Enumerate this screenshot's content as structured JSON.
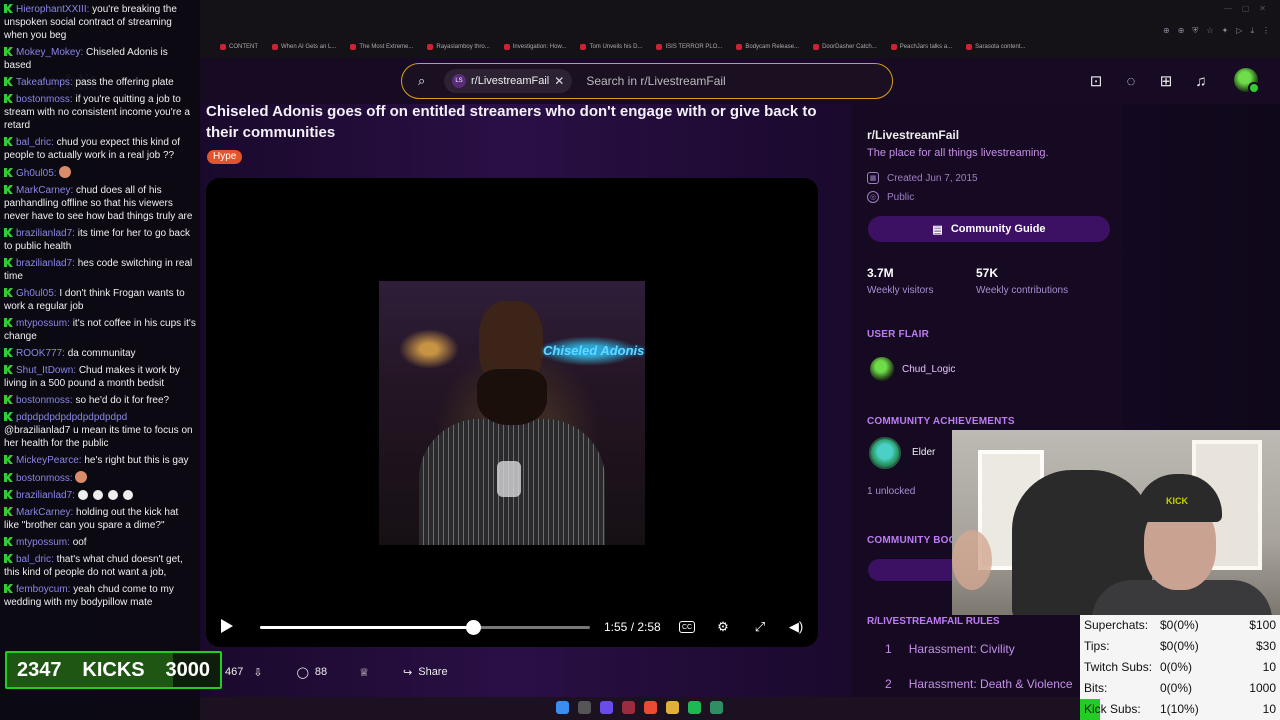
{
  "chat": {
    "messages": [
      {
        "user": "HierophantXXIII:",
        "text": "you're breaking the unspoken social contract of streaming when you beg"
      },
      {
        "user": "Mokey_Mokey:",
        "text": "Chiseled Adonis is based"
      },
      {
        "user": "Takeafumps:",
        "text": "pass the offering plate"
      },
      {
        "user": "bostonmoss:",
        "text": "if you're quitting a job to stream with no consistent income you're a retard"
      },
      {
        "user": "bal_dric:",
        "text": "chud you expect this kind of people to actually work in a real job ??"
      },
      {
        "user": "Gh0ul05:",
        "text": ""
      },
      {
        "user": "MarkCarney:",
        "text": "chud does all of his panhandling offline so that his viewers never have to see how bad things truly are"
      },
      {
        "user": "brazilianlad7:",
        "text": "its time for her to go back to public health"
      },
      {
        "user": "brazilianlad7:",
        "text": "hes code switching in real time"
      },
      {
        "user": "Gh0ul05:",
        "text": "I don't think Frogan wants to work a regular job"
      },
      {
        "user": "mtypossum:",
        "text": "it's not coffee in his cups it's change"
      },
      {
        "user": "ROOK777:",
        "text": "da communitay"
      },
      {
        "user": "Shut_ItDown:",
        "text": "Chud makes it work by living in a 500 pound a month bedsit"
      },
      {
        "user": "bostonmoss:",
        "text": "so he'd do it for free?"
      },
      {
        "user": "pdpdpdpdpdpdpdpdpdpd",
        "text": "@brazilianlad7 u mean its time to focus on her health for the public"
      },
      {
        "user": "MickeyPearce:",
        "text": "he's right but this is gay"
      },
      {
        "user": "bostonmoss:",
        "text": ""
      },
      {
        "user": "brazilianlad7:",
        "text": ""
      },
      {
        "user": "MarkCarney:",
        "text": "holding out the kick hat like \"brother can you spare a dime?\""
      },
      {
        "user": "mtypossum:",
        "text": "oof"
      },
      {
        "user": "bal_dric:",
        "text": "that's what chud doesn't get, this kind of people do not want a job,"
      },
      {
        "user": "femboycum:",
        "text": "yeah chud come to my wedding with my bodypillow mate"
      }
    ]
  },
  "kicks": {
    "current": "2347",
    "label": "KICKS",
    "goal": "3000",
    "progress": 0.78
  },
  "browser_tabs": [
    "CONTENT",
    "When AI Gets an L...",
    "The Most Extreme...",
    "Rayaslamboy thro...",
    "Investigation: How...",
    "Tom Unveils his D...",
    "ISIS TERROR PLO...",
    "Bodycam Release...",
    "DoorDasher Catch...",
    "PeachJars talks a...",
    "Sarasota content..."
  ],
  "header": {
    "logo": "reddit",
    "search_chip": "r/LivestreamFail",
    "search_chip_badge": "LS",
    "search_placeholder": "Search in r/LivestreamFail",
    "icons": [
      "ad-icon",
      "chat-icon",
      "create-icon",
      "bell-icon"
    ]
  },
  "post": {
    "title": "Chiseled Adonis goes off on entitled streamers who don't engage with or give back to their communities",
    "flair": "Hype",
    "video_overlay_text": "Chiseled Adonis",
    "time_current": "1:55",
    "time_total": "2:58",
    "progress": 0.646,
    "upvotes": "467",
    "comments": "88",
    "share_label": "Share"
  },
  "sidebar": {
    "sub_name": "r/LivestreamFail",
    "description": "The place for all things livestreaming.",
    "created": "Created Jun 7, 2015",
    "visibility": "Public",
    "guide_button": "Community Guide",
    "stats": [
      {
        "value": "3.7M",
        "label": "Weekly visitors"
      },
      {
        "value": "57K",
        "label": "Weekly contributions"
      }
    ],
    "user_flair_heading": "USER FLAIR",
    "user_flair_name": "Chud_Logic",
    "achievements_heading": "COMMUNITY ACHIEVEMENTS",
    "achievement_name": "Elder",
    "achievements_unlocked": "1 unlocked",
    "bookmarks_heading": "COMMUNITY BOO",
    "rules_heading": "R/LIVESTREAMFAIL RULES",
    "rules": [
      {
        "num": "1",
        "text": "Harassment: Civility"
      },
      {
        "num": "2",
        "text": "Harassment: Death & Violence"
      }
    ]
  },
  "goals": [
    {
      "label": "Superchats:",
      "value": "$0(0%)",
      "target": "$100"
    },
    {
      "label": "Tips:",
      "value": "$0(0%)",
      "target": "$30"
    },
    {
      "label": "Twitch Subs:",
      "value": "0(0%)",
      "target": "10"
    },
    {
      "label": "Bits:",
      "value": "0(0%)",
      "target": "1000"
    },
    {
      "label": "Kick Subs:",
      "value": "1(10%)",
      "target": "10"
    }
  ],
  "colors": {
    "accent": "#bd7cf4",
    "search_border": "#d9a018",
    "kick_green": "#33cc33",
    "button_bg": "#3c1063"
  }
}
